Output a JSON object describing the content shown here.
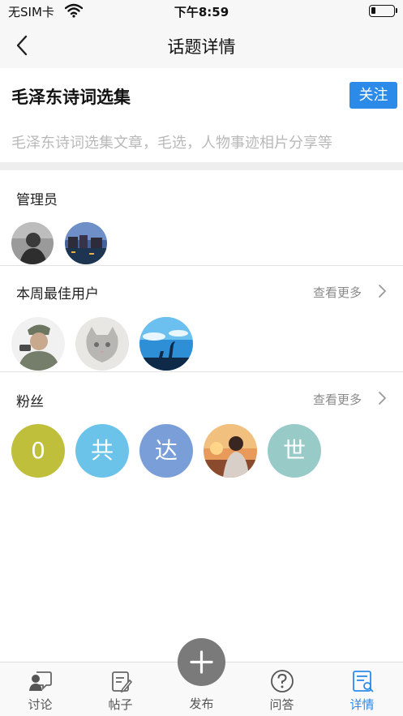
{
  "status_bar": {
    "carrier": "无SIM卡",
    "time": "下午8:59"
  },
  "nav": {
    "title": "话题详情",
    "back_icon": "chevron-left-icon"
  },
  "topic": {
    "title": "毛泽东诗词选集",
    "follow_label": "关注",
    "description": "毛泽东诗词选集文章，毛选，人物事迹相片分享等",
    "accent_color": "#2c8ae9"
  },
  "admins": {
    "title": "管理员",
    "avatars": [
      "portrait-photo",
      "river-town-photo"
    ]
  },
  "best_users": {
    "title": "本周最佳用户",
    "see_more": "查看更多",
    "avatars": [
      "soldier-illustration",
      "cat-photo",
      "crane-silhouette-photo"
    ]
  },
  "fans": {
    "title": "粉丝",
    "see_more": "查看更多",
    "avatars": [
      {
        "label": "0",
        "color": "#bfbf3c"
      },
      {
        "label": "共",
        "color": "#6cc3ea"
      },
      {
        "label": "达",
        "color": "#7a9fd8"
      },
      {
        "label": "",
        "color": "#c87a4a",
        "kind": "sunset-portrait-photo"
      },
      {
        "label": "世",
        "color": "#98cac8"
      }
    ]
  },
  "tab_bar": {
    "tabs": [
      {
        "label": "讨论",
        "icon": "discussion-icon"
      },
      {
        "label": "帖子",
        "icon": "post-icon"
      },
      {
        "label": "发布",
        "icon": "plus-icon"
      },
      {
        "label": "问答",
        "icon": "question-icon"
      },
      {
        "label": "详情",
        "icon": "details-icon",
        "active": true
      }
    ]
  }
}
